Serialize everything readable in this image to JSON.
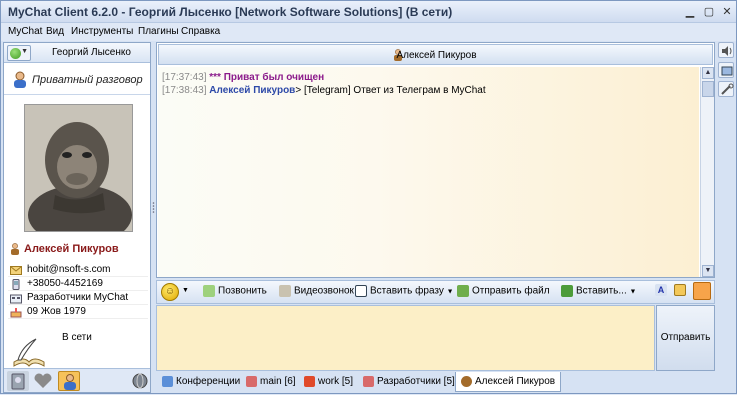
{
  "window": {
    "title": "MyChat Client 6.2.0 - Георгий Лысенко [Network Software Solutions] (В сети)"
  },
  "menu": [
    "MyChat",
    "Вид",
    "Инструменты",
    "Плагины",
    "Справка"
  ],
  "left": {
    "my_name": "Георгий Лысенко",
    "private_label": "Приватный разговор",
    "user_name": "Алексей Пикуров",
    "email": "hobit@nsoft-s.com",
    "phone": "+38050-4452169",
    "department": "Разработчики MyChat",
    "birthday": "09 Жов 1979",
    "status_text": "В сети"
  },
  "chat": {
    "header": "Алексей Пикуров",
    "messages": [
      {
        "time": "[17:37:43]",
        "system": "*** Приват был очищен"
      },
      {
        "time": "[17:38:43]",
        "nick": "Алексей Пикуров",
        "sep": ">",
        "text": " [Telegram] Ответ из Телеграм в MyChat"
      }
    ]
  },
  "toolbar": {
    "call": "Позвонить",
    "video": "Видеозвонок",
    "insert_phrase": "Вставить фразу",
    "send_file": "Отправить файл",
    "insert": "Вставить..."
  },
  "send_label": "Отправить",
  "tabs": [
    {
      "label": "Конференции"
    },
    {
      "label": "main [6]"
    },
    {
      "label": "work [5]"
    },
    {
      "label": "Разработчики [5]"
    },
    {
      "label": "Алексей Пикуров"
    }
  ],
  "colors": {
    "system": "#8b1a8b",
    "nick": "#2d49a8",
    "user_name": "#8a1a1a",
    "input_bg": "#fcefc7"
  }
}
